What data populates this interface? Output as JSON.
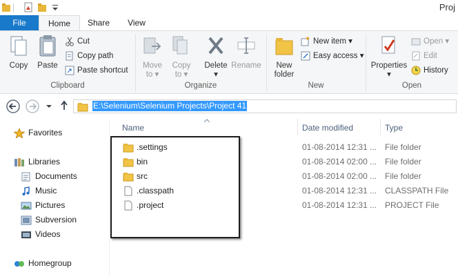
{
  "window": {
    "title": "Proj"
  },
  "tabs": {
    "file": "File",
    "home": "Home",
    "share": "Share",
    "view": "View"
  },
  "ribbon": {
    "clipboard": {
      "copy": "Copy",
      "paste": "Paste",
      "cut": "Cut",
      "copy_path": "Copy path",
      "paste_shortcut": "Paste shortcut",
      "label": "Clipboard"
    },
    "organize": {
      "move_to": "Move",
      "move_to_2": "to",
      "copy_to": "Copy",
      "copy_to_2": "to",
      "delete": "Delete",
      "rename": "Rename",
      "label": "Organize"
    },
    "new": {
      "new_folder": "New",
      "new_folder_2": "folder",
      "new_item": "New item",
      "easy_access": "Easy access",
      "label": "New"
    },
    "open": {
      "properties": "Properties",
      "open": "Open",
      "edit": "Edit",
      "history": "History",
      "label": "Open"
    }
  },
  "address": {
    "path": "E:\\Selenium\\Selenium Projects\\Project 41"
  },
  "navigation": {
    "favorites": "Favorites",
    "libraries": "Libraries",
    "documents": "Documents",
    "music": "Music",
    "pictures": "Pictures",
    "subversion": "Subversion",
    "videos": "Videos",
    "homegroup": "Homegroup"
  },
  "columns": {
    "name": "Name",
    "date": "Date modified",
    "type": "Type"
  },
  "files": [
    {
      "name": ".settings",
      "date": "01-08-2014 12:31 ...",
      "type": "File folder",
      "icon": "folder-icon"
    },
    {
      "name": "bin",
      "date": "01-08-2014 02:00 ...",
      "type": "File folder",
      "icon": "folder-icon"
    },
    {
      "name": "src",
      "date": "01-08-2014 02:00 ...",
      "type": "File folder",
      "icon": "folder-icon"
    },
    {
      "name": ".classpath",
      "date": "01-08-2014 12:31 ...",
      "type": "CLASSPATH File",
      "icon": "file-icon"
    },
    {
      "name": ".project",
      "date": "01-08-2014 12:31 ...",
      "type": "PROJECT File",
      "icon": "file-icon"
    }
  ],
  "colors": {
    "accent": "#1979ca",
    "selection": "#3399ff",
    "ribbon_bg": "#f5f6f7"
  }
}
